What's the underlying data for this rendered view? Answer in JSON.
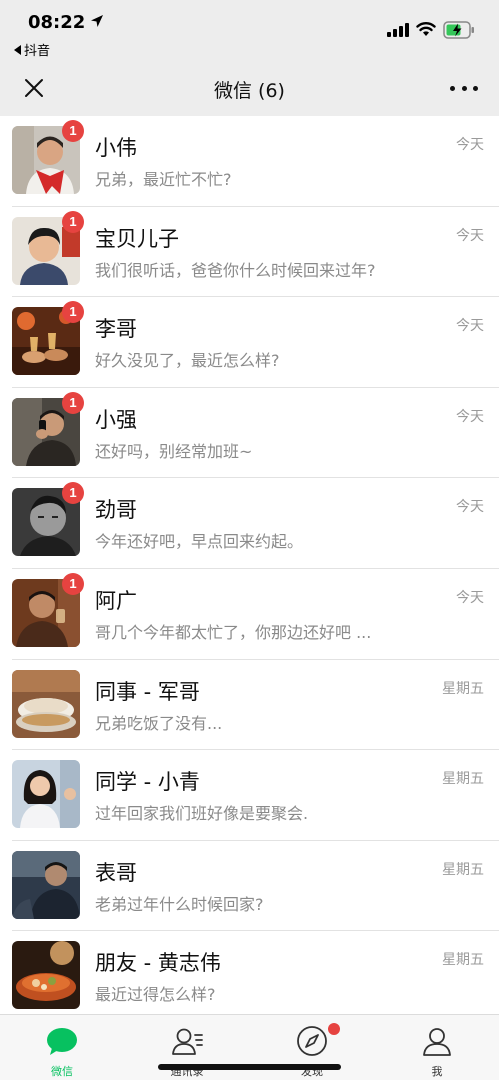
{
  "status_bar": {
    "time": "08:22",
    "back_app": "抖音"
  },
  "nav": {
    "title": "微信 (6)"
  },
  "chats": [
    {
      "name": "小伟",
      "message": "兄弟，最近忙不忙?",
      "time": "今天",
      "unread": "1",
      "avatar": "avatar-man-red-scarf"
    },
    {
      "name": "宝贝儿子",
      "message": "我们很听话，爸爸你什么时候回来过年?",
      "time": "今天",
      "unread": "1",
      "avatar": "avatar-boy"
    },
    {
      "name": "李哥",
      "message": "好久没见了，最近怎么样?",
      "time": "今天",
      "unread": "1",
      "avatar": "avatar-toast"
    },
    {
      "name": "小强",
      "message": "还好吗，别经常加班~",
      "time": "今天",
      "unread": "1",
      "avatar": "avatar-man-phone"
    },
    {
      "name": "劲哥",
      "message": "今年还好吧，早点回来约起。",
      "time": "今天",
      "unread": "1",
      "avatar": "avatar-man-bw"
    },
    {
      "name": "阿广",
      "message": "哥几个今年都太忙了，你那边还好吧 ...",
      "time": "今天",
      "unread": "1",
      "avatar": "avatar-man-drinking"
    },
    {
      "name": "同事 - 军哥",
      "message": "兄弟吃饭了没有...",
      "time": "星期五",
      "unread": "",
      "avatar": "avatar-food"
    },
    {
      "name": "同学 - 小青",
      "message": "过年回家我们班好像是要聚会.",
      "time": "星期五",
      "unread": "",
      "avatar": "avatar-woman"
    },
    {
      "name": "表哥",
      "message": "老弟过年什么时候回家?",
      "time": "星期五",
      "unread": "",
      "avatar": "avatar-man-dark"
    },
    {
      "name": "朋友 - 黄志伟",
      "message": "最近过得怎么样?",
      "time": "星期五",
      "unread": "",
      "avatar": "avatar-hotpot"
    }
  ],
  "tabs": [
    {
      "label": "微信",
      "icon": "chat-bubble-icon",
      "active": true
    },
    {
      "label": "通讯录",
      "icon": "contacts-icon",
      "active": false
    },
    {
      "label": "发现",
      "icon": "compass-icon",
      "active": false
    },
    {
      "label": "我",
      "icon": "profile-icon",
      "active": false
    }
  ],
  "colors": {
    "accent": "#07c160",
    "badge": "#e64340",
    "header_bg": "#ededed"
  }
}
